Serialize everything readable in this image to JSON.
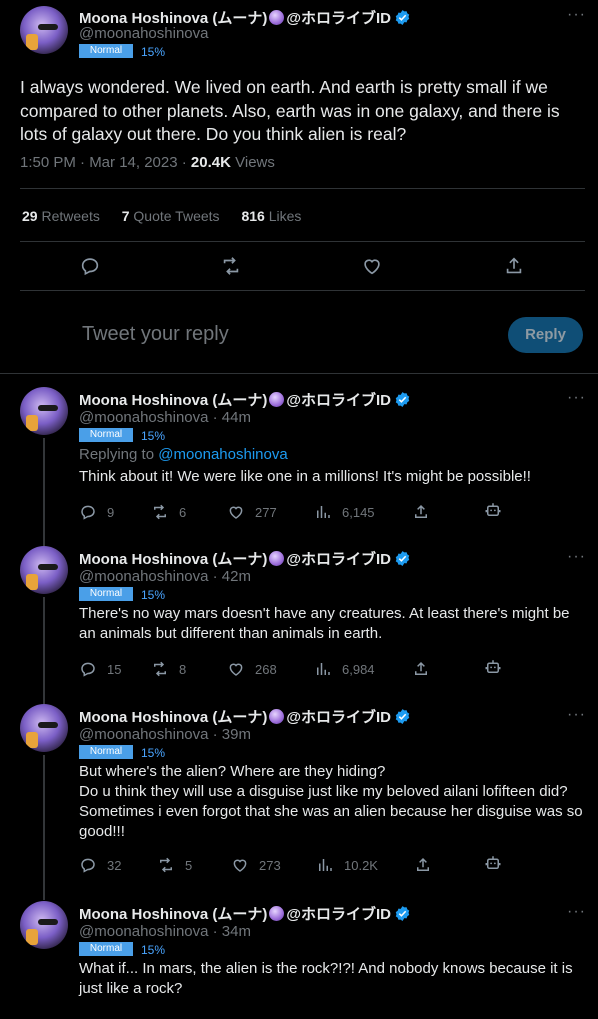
{
  "main": {
    "display_name": "Moona Hoshinova (ムーナ)",
    "name_suffix": "@ホロライブID",
    "handle": "@moonahoshinova",
    "badge": "Normal",
    "badge_pct": "15%",
    "text": "I always wondered. We lived on earth. And earth is pretty small if we compared to other planets. Also, earth was in one galaxy, and there is lots of galaxy out there. Do you think alien is real?",
    "time": "1:50 PM · Mar 14, 2023 ·",
    "views_count": "20.4K",
    "views_label": "Views",
    "retweets_count": "29",
    "retweets_label": "Retweets",
    "quotes_count": "7",
    "quotes_label": "Quote Tweets",
    "likes_count": "816",
    "likes_label": "Likes"
  },
  "composer": {
    "placeholder": "Tweet your reply",
    "button": "Reply"
  },
  "replies": [
    {
      "display_name": "Moona Hoshinova (ムーナ)",
      "name_suffix": "@ホロライブID",
      "handle_time": "@moonahoshinova · 44m",
      "badge": "Normal",
      "badge_pct": "15%",
      "replying_label": "Replying to",
      "replying_to": "@moonahoshinova",
      "text": "Think about it! We were like one in a millions! It's might be possible!!",
      "replies": "9",
      "retweets": "6",
      "likes": "277",
      "views": "6,145"
    },
    {
      "display_name": "Moona Hoshinova (ムーナ)",
      "name_suffix": "@ホロライブID",
      "handle_time": "@moonahoshinova · 42m",
      "badge": "Normal",
      "badge_pct": "15%",
      "text": "There's no way mars doesn't have any creatures. At least there's might be an animals but different than animals in earth.",
      "replies": "15",
      "retweets": "8",
      "likes": "268",
      "views": "6,984"
    },
    {
      "display_name": "Moona Hoshinova (ムーナ)",
      "name_suffix": "@ホロライブID",
      "handle_time": "@moonahoshinova · 39m",
      "badge": "Normal",
      "badge_pct": "15%",
      "text_lines": [
        "But where's the alien? Where are they hiding?",
        "Do u think they will use a disguise just like my beloved ailani lofifteen did? Sometimes i even forgot that she was an alien because her disguise was so good!!!"
      ],
      "replies": "32",
      "retweets": "5",
      "likes": "273",
      "views": "10.2K"
    },
    {
      "display_name": "Moona Hoshinova (ムーナ)",
      "name_suffix": "@ホロライブID",
      "handle_time": "@moonahoshinova · 34m",
      "badge": "Normal",
      "badge_pct": "15%",
      "text": "What if... In mars, the alien is the rock?!?! And nobody knows because it is just like a rock?"
    }
  ],
  "colors": {
    "accent": "#1d9bf0",
    "badge": "#4a9fe8",
    "muted": "#71767b",
    "border": "#2f3336"
  }
}
